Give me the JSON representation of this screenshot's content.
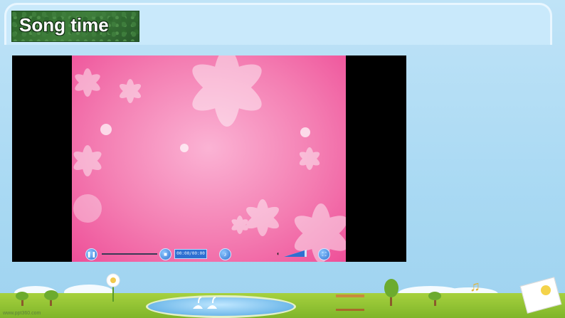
{
  "slide": {
    "title": "Song time"
  },
  "player": {
    "time_display": "00:00/00:00",
    "progress": 0.0,
    "volume_level": 0.9,
    "icons": {
      "play_pause": "pause-icon",
      "stop": "stop-icon",
      "music": "music-note-icon",
      "volume": "speaker-icon",
      "fullscreen": "fullscreen-icon"
    }
  },
  "footer": {
    "watermark": "www.ppt360.com"
  },
  "colors": {
    "video_pink": "#f47fb3",
    "control_blue": "#2f6fd0",
    "title_green": "#2b6429"
  }
}
